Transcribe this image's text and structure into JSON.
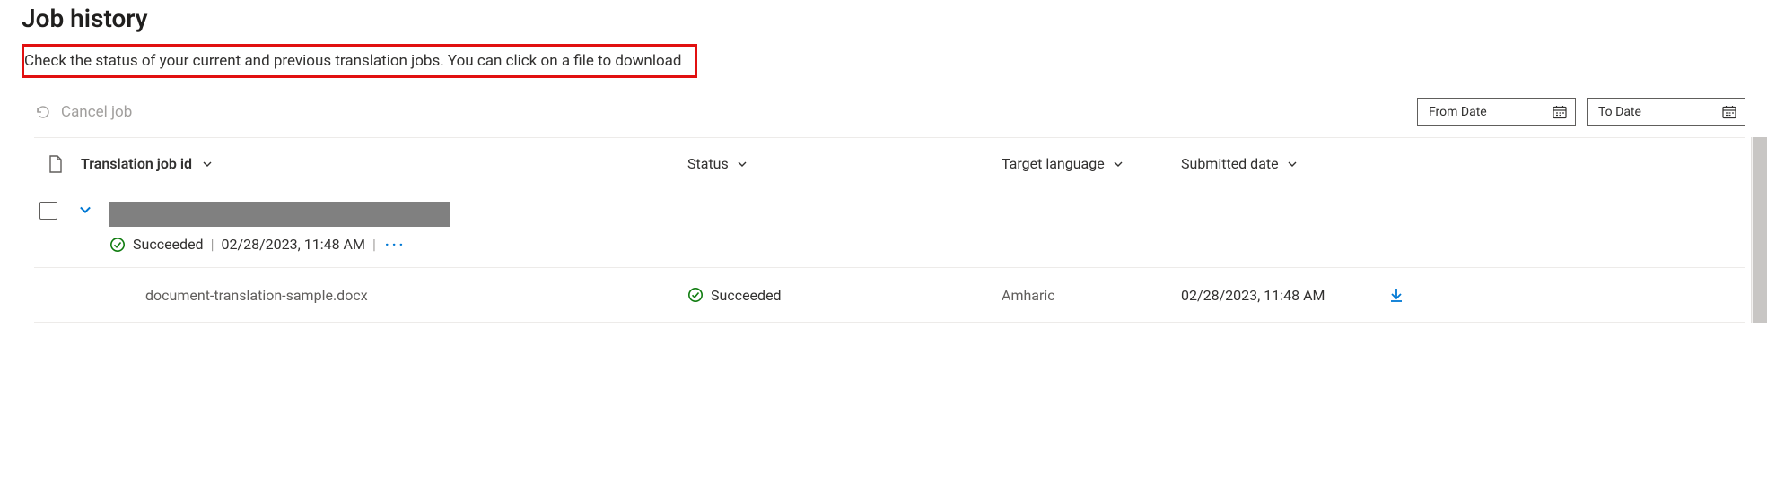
{
  "header": {
    "title": "Job history",
    "subtitle": "Check the status of your current and previous translation jobs. You can click on a file to download"
  },
  "toolbar": {
    "cancel_label": "Cancel job",
    "from_date_label": "From Date",
    "to_date_label": "To Date"
  },
  "table": {
    "columns": {
      "job_id": "Translation job id",
      "status": "Status",
      "target_language": "Target language",
      "submitted_date": "Submitted date"
    }
  },
  "group": {
    "status_text": "Succeeded",
    "timestamp": "02/28/2023, 11:48 AM"
  },
  "row": {
    "file_name": "document-translation-sample.docx",
    "status": "Succeeded",
    "target_language": "Amharic",
    "submitted_date": "02/28/2023, 11:48 AM"
  }
}
